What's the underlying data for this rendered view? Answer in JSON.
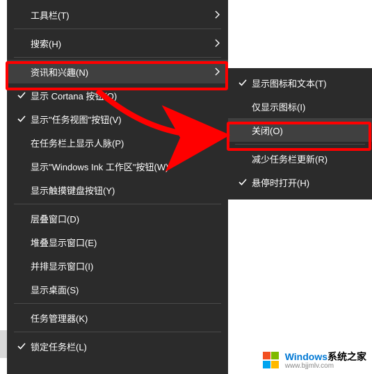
{
  "primary_menu": {
    "items": [
      {
        "label": "工具栏(T)",
        "checked": false,
        "has_submenu": true
      },
      {
        "label": "搜索(H)",
        "checked": false,
        "has_submenu": true
      },
      {
        "label": "资讯和兴趣(N)",
        "checked": false,
        "has_submenu": true,
        "hover": true
      },
      {
        "label": "显示 Cortana 按钮(O)",
        "checked": true,
        "has_submenu": false
      },
      {
        "label": "显示\"任务视图\"按钮(V)",
        "checked": true,
        "has_submenu": false
      },
      {
        "label": "在任务栏上显示人脉(P)",
        "checked": false,
        "has_submenu": false
      },
      {
        "label": "显示\"Windows Ink 工作区\"按钮(W)",
        "checked": false,
        "has_submenu": false
      },
      {
        "label": "显示触摸键盘按钮(Y)",
        "checked": false,
        "has_submenu": false
      },
      {
        "label": "层叠窗口(D)",
        "checked": false,
        "has_submenu": false
      },
      {
        "label": "堆叠显示窗口(E)",
        "checked": false,
        "has_submenu": false
      },
      {
        "label": "并排显示窗口(I)",
        "checked": false,
        "has_submenu": false
      },
      {
        "label": "显示桌面(S)",
        "checked": false,
        "has_submenu": false
      },
      {
        "label": "任务管理器(K)",
        "checked": false,
        "has_submenu": false
      },
      {
        "label": "锁定任务栏(L)",
        "checked": true,
        "has_submenu": false
      }
    ],
    "separators_after": [
      0,
      1,
      7,
      11,
      12
    ]
  },
  "secondary_menu": {
    "items": [
      {
        "label": "显示图标和文本(T)",
        "checked": true,
        "hover": false
      },
      {
        "label": "仅显示图标(I)",
        "checked": false,
        "hover": false
      },
      {
        "label": "关闭(O)",
        "checked": false,
        "hover": true
      },
      {
        "label": "减少任务栏更新(R)",
        "checked": false,
        "hover": false
      },
      {
        "label": "悬停时打开(H)",
        "checked": true,
        "hover": false
      }
    ],
    "separators_after": [
      2
    ]
  },
  "watermark": {
    "brand_colored": "Windows",
    "brand_rest": "系统之家",
    "url": "www.bjjmlv.com",
    "logo_colors": [
      "#f25022",
      "#7fba00",
      "#00a4ef",
      "#ffb900"
    ]
  }
}
